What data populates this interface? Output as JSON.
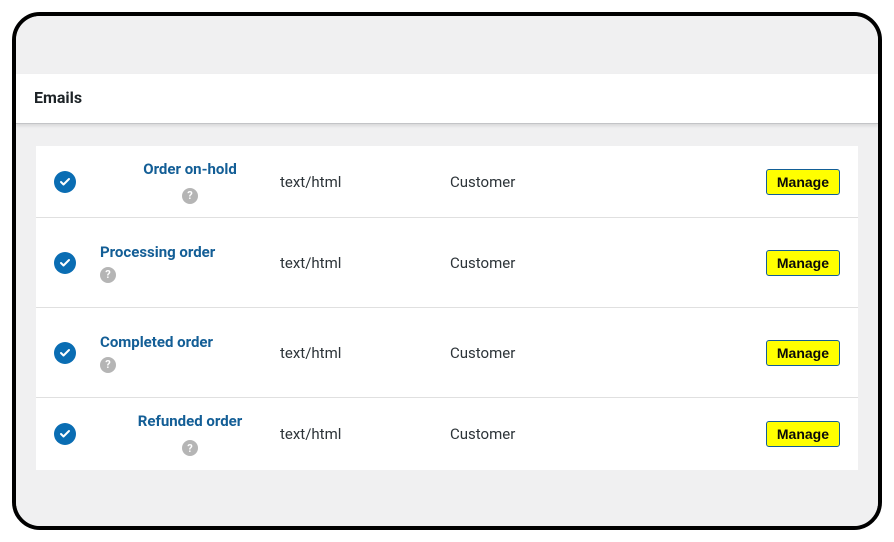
{
  "section_title": "Emails",
  "manage_label": "Manage",
  "rows": [
    {
      "name": "Order on-hold",
      "type": "text/html",
      "recipient": "Customer",
      "help_inline": true
    },
    {
      "name": "Processing order",
      "type": "text/html",
      "recipient": "Customer",
      "help_inline": false
    },
    {
      "name": "Completed order",
      "type": "text/html",
      "recipient": "Customer",
      "help_inline": false
    },
    {
      "name": "Refunded order",
      "type": "text/html",
      "recipient": "Customer",
      "help_inline": true
    }
  ]
}
